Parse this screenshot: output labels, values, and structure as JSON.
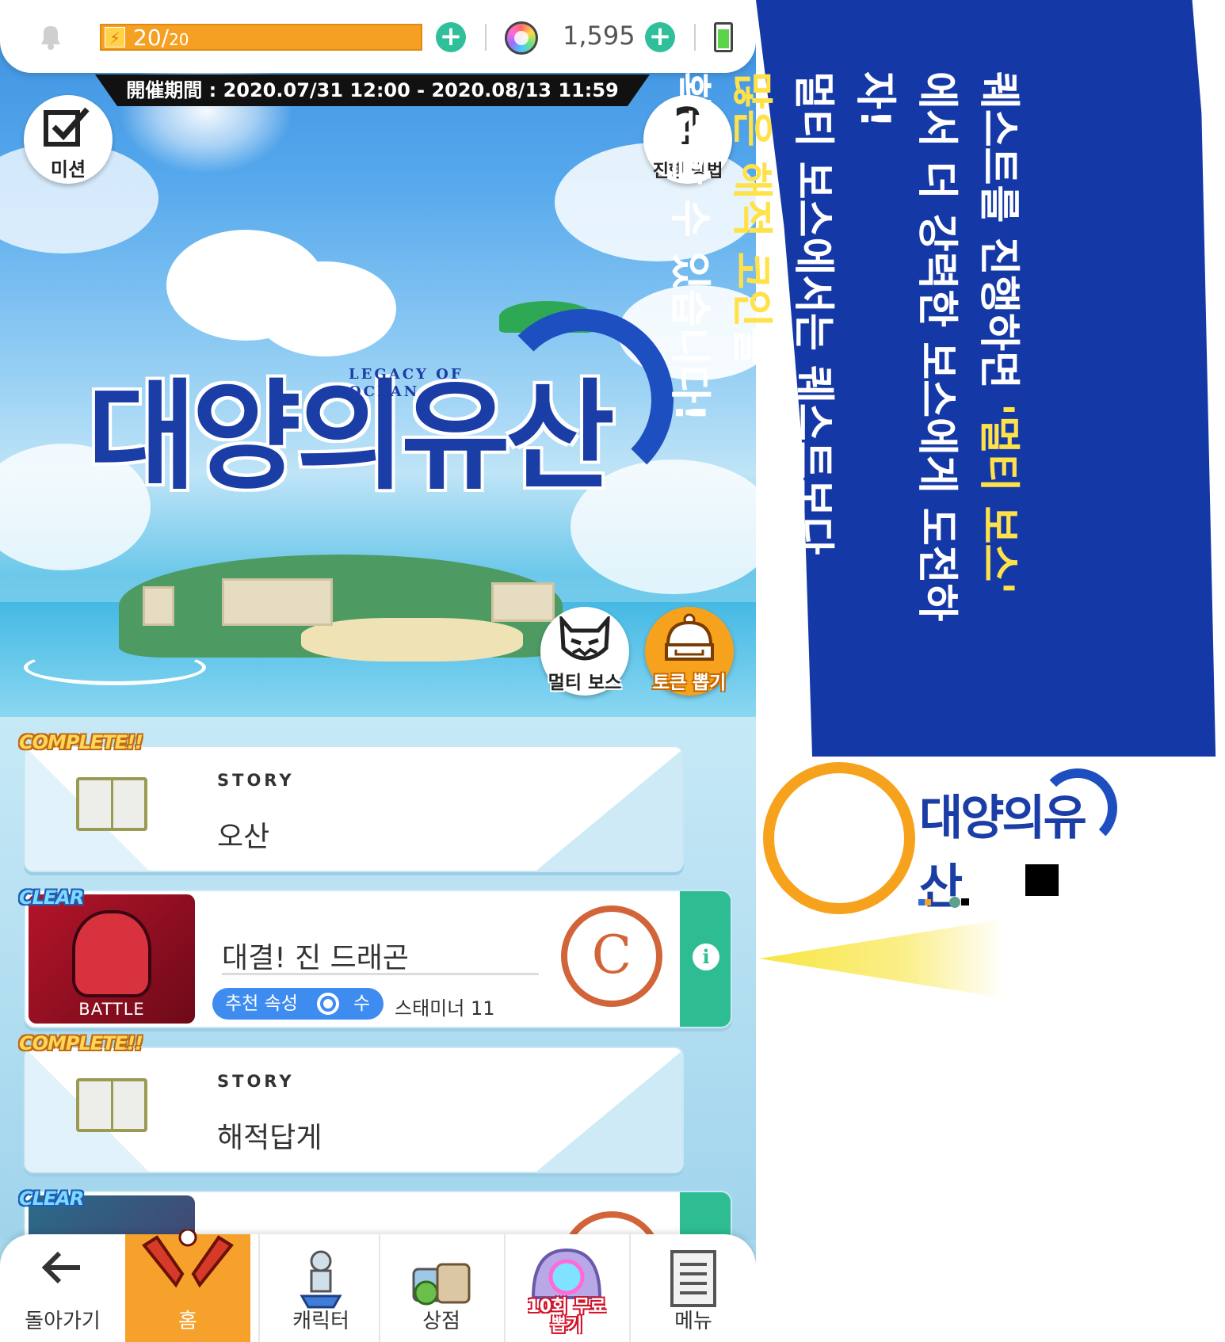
{
  "status_bar": {
    "stamina": "20/",
    "stamina_max": "20",
    "gem_count": "1,595"
  },
  "event_period": "開催期間 : 2020.07/31 12:00 - 2020.08/13 11:59",
  "hero": {
    "mission_label": "미션",
    "howto_label": "진행 방법",
    "logo_text": "대양의유산",
    "logo_en": "LEGACY OF OCEAN",
    "multi_boss_label": "멀티 보스",
    "token_gacha_label": "토큰 뽑기"
  },
  "quests": [
    {
      "badge": "COMPLETE!!",
      "category": "STORY",
      "title": "오산"
    },
    {
      "badge": "CLEAR",
      "type_label": "BATTLE",
      "title": "대결! 진 드래곤",
      "recommend_label": "추천 속성",
      "recommend_value": "수",
      "stamina_note": "스태미너 11",
      "rank": "C"
    },
    {
      "badge": "COMPLETE!!",
      "category": "STORY",
      "title": "해적답게"
    },
    {
      "badge": "CLEAR"
    }
  ],
  "bottom_nav": {
    "back": "돌아가기",
    "home": "홈",
    "character": "캐릭터",
    "shop": "상점",
    "gacha_badge_line1": "10회 무료",
    "gacha_badge_line2": "뽑기",
    "menu": "메뉴"
  },
  "promo": {
    "line1_before": "퀘스트를 진행하면 ",
    "line1_highlight": "'멀티 보스'",
    "line2": "에서 더 강력한 보스에게 도전하자!",
    "line3": "멀티 보스에서는 퀘스트보다",
    "line4_highlight": "많은 해적 코인",
    "line4_after": "을",
    "line5": "획득할 수 있습니다!"
  },
  "small_logo_text": "대양의유산",
  "colors": {
    "accent_orange": "#f5a12b",
    "brand_blue": "#1438a6",
    "highlight_yellow": "#ffe24a",
    "teal": "#2ebd93"
  }
}
